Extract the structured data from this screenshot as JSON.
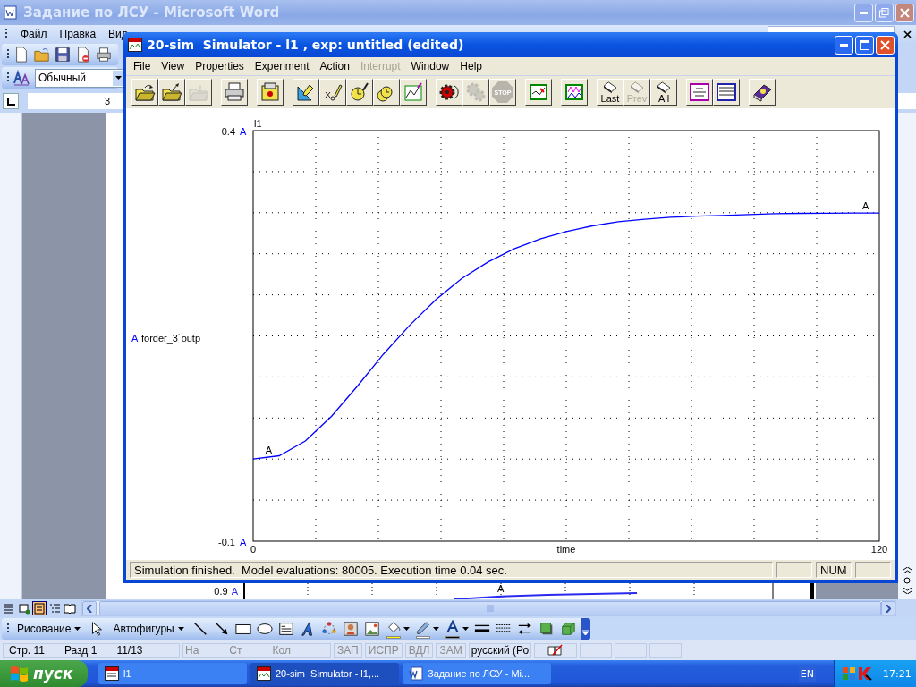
{
  "word_window": {
    "title": "Задание по ЛСУ - Microsoft Word",
    "active": false,
    "menu": [
      "Файл",
      "Правка",
      "Вид"
    ],
    "standard_toolbar": [
      {
        "kind": "new"
      },
      {
        "kind": "open"
      },
      {
        "kind": "save"
      },
      {
        "kind": "permission"
      },
      {
        "kind": "print"
      }
    ],
    "style_box": {
      "value": "Обычный"
    },
    "ruler_number": "3",
    "doc_figure": {
      "scale_label": "0.9",
      "scale_marker": "A",
      "curve_marker": "A"
    },
    "view_buttons": [
      {
        "kind": "normal",
        "selected": false
      },
      {
        "kind": "web",
        "selected": false
      },
      {
        "kind": "print-layout",
        "selected": true
      },
      {
        "kind": "outline",
        "selected": false
      },
      {
        "kind": "reading",
        "selected": false
      }
    ],
    "drawing_toolbar": [
      {
        "kind": "menu",
        "label": "Рисование"
      },
      {
        "kind": "select"
      },
      {
        "kind": "menu",
        "label": "Автофигуры"
      },
      {
        "kind": "line"
      },
      {
        "kind": "arrow"
      },
      {
        "kind": "rectangle"
      },
      {
        "kind": "oval"
      },
      {
        "kind": "textbox"
      },
      {
        "kind": "wordart"
      },
      {
        "kind": "diagram"
      },
      {
        "kind": "clipart"
      },
      {
        "kind": "picture"
      },
      {
        "kind": "fill-color",
        "color": "#ffff00"
      },
      {
        "kind": "line-color",
        "color": "#ffffff"
      },
      {
        "kind": "font-color",
        "color": "#000000"
      },
      {
        "kind": "line-style"
      },
      {
        "kind": "dash-style"
      },
      {
        "kind": "arrow-style"
      },
      {
        "kind": "shadow"
      },
      {
        "kind": "cube"
      }
    ],
    "status_bar": {
      "position": [
        "Стр. 11",
        "Разд 1",
        "11/13"
      ],
      "location": [
        "На",
        "Ст",
        "Кол"
      ],
      "modes": [
        {
          "label": "ЗАП",
          "on": false
        },
        {
          "label": "ИСПР",
          "on": false
        },
        {
          "label": "ВДЛ",
          "on": false
        },
        {
          "label": "ЗАМ",
          "on": false
        }
      ],
      "language": "русский (Ро"
    }
  },
  "simulator_window": {
    "title": "20-sim  Simulator - l1 , exp: untitled (edited)",
    "active": true,
    "menu": [
      {
        "label": "File",
        "disabled": false
      },
      {
        "label": "View",
        "disabled": false
      },
      {
        "label": "Properties",
        "disabled": false
      },
      {
        "label": "Experiment",
        "disabled": false
      },
      {
        "label": "Action",
        "disabled": false
      },
      {
        "label": "Interrupt",
        "disabled": true
      },
      {
        "label": "Window",
        "disabled": false
      },
      {
        "label": "Help",
        "disabled": false
      }
    ],
    "toolbar": [
      [
        {
          "kind": "open",
          "disabled": false
        },
        {
          "kind": "save",
          "disabled": false
        },
        {
          "kind": "import",
          "disabled": true
        }
      ],
      [
        {
          "kind": "print",
          "disabled": false
        }
      ],
      [
        {
          "kind": "model",
          "disabled": false
        }
      ],
      [
        {
          "kind": "parameters",
          "disabled": false
        },
        {
          "kind": "initial-values",
          "disabled": false
        },
        {
          "kind": "run-setup",
          "disabled": false
        },
        {
          "kind": "multiple-run",
          "disabled": false
        },
        {
          "kind": "plot-properties",
          "disabled": false
        }
      ],
      [
        {
          "kind": "run",
          "disabled": false
        },
        {
          "kind": "replay",
          "disabled": true
        },
        {
          "kind": "stop",
          "label": "STOP",
          "disabled": true
        }
      ],
      [
        {
          "kind": "plot",
          "disabled": false
        }
      ],
      [
        {
          "kind": "plot-2",
          "disabled": false
        }
      ],
      [
        {
          "kind": "erase",
          "label": "Last",
          "disabled": false
        },
        {
          "kind": "erase",
          "label": "Prev",
          "disabled": true
        },
        {
          "kind": "erase",
          "label": "All",
          "disabled": false
        }
      ],
      [
        {
          "kind": "equations",
          "disabled": false
        },
        {
          "kind": "equations-2",
          "disabled": false
        }
      ],
      [
        {
          "kind": "help",
          "disabled": false
        }
      ]
    ],
    "plot": {
      "legend_marker": "A",
      "scale_markers": [
        "A",
        "A"
      ],
      "curve_markers": [
        "A",
        "A"
      ],
      "chart_data": {
        "type": "line",
        "title": "l1",
        "xlabel": "time",
        "x": [
          0,
          5,
          10,
          15,
          20,
          25,
          30,
          35,
          40,
          45,
          50,
          55,
          60,
          65,
          70,
          75,
          80,
          85,
          90,
          95,
          100,
          105,
          110,
          115,
          120
        ],
        "series": [
          {
            "name": "forder_3`outp",
            "color": "#0000ff",
            "values": [
              0,
              0.004,
              0.022,
              0.052,
              0.089,
              0.128,
              0.163,
              0.194,
              0.22,
              0.24,
              0.256,
              0.268,
              0.277,
              0.284,
              0.289,
              0.292,
              0.2944,
              0.2958,
              0.2967,
              0.2978,
              0.2988,
              0.2992,
              0.2994,
              0.2996,
              0.2997
            ]
          }
        ],
        "xlim": [
          0,
          120
        ],
        "ylim": [
          -0.1,
          0.4
        ],
        "xticks": [
          0,
          120
        ],
        "yticks": [
          -0.1,
          0.4
        ]
      }
    },
    "status_bar": {
      "message": "Simulation finished.  Model evaluations: 80005. Execution time 0.04 sec.",
      "indicators": [
        "NUM"
      ]
    }
  },
  "taskbar": {
    "start": "пуск",
    "tasks": [
      {
        "kind": "model",
        "label": "l1",
        "selected": false
      },
      {
        "kind": "simulator",
        "label": "20-sim  Simulator - l1,...",
        "selected": true
      },
      {
        "kind": "word",
        "label": "Задание по ЛСУ - Mi...",
        "selected": false
      }
    ],
    "language": "EN",
    "clock": "17:21"
  }
}
